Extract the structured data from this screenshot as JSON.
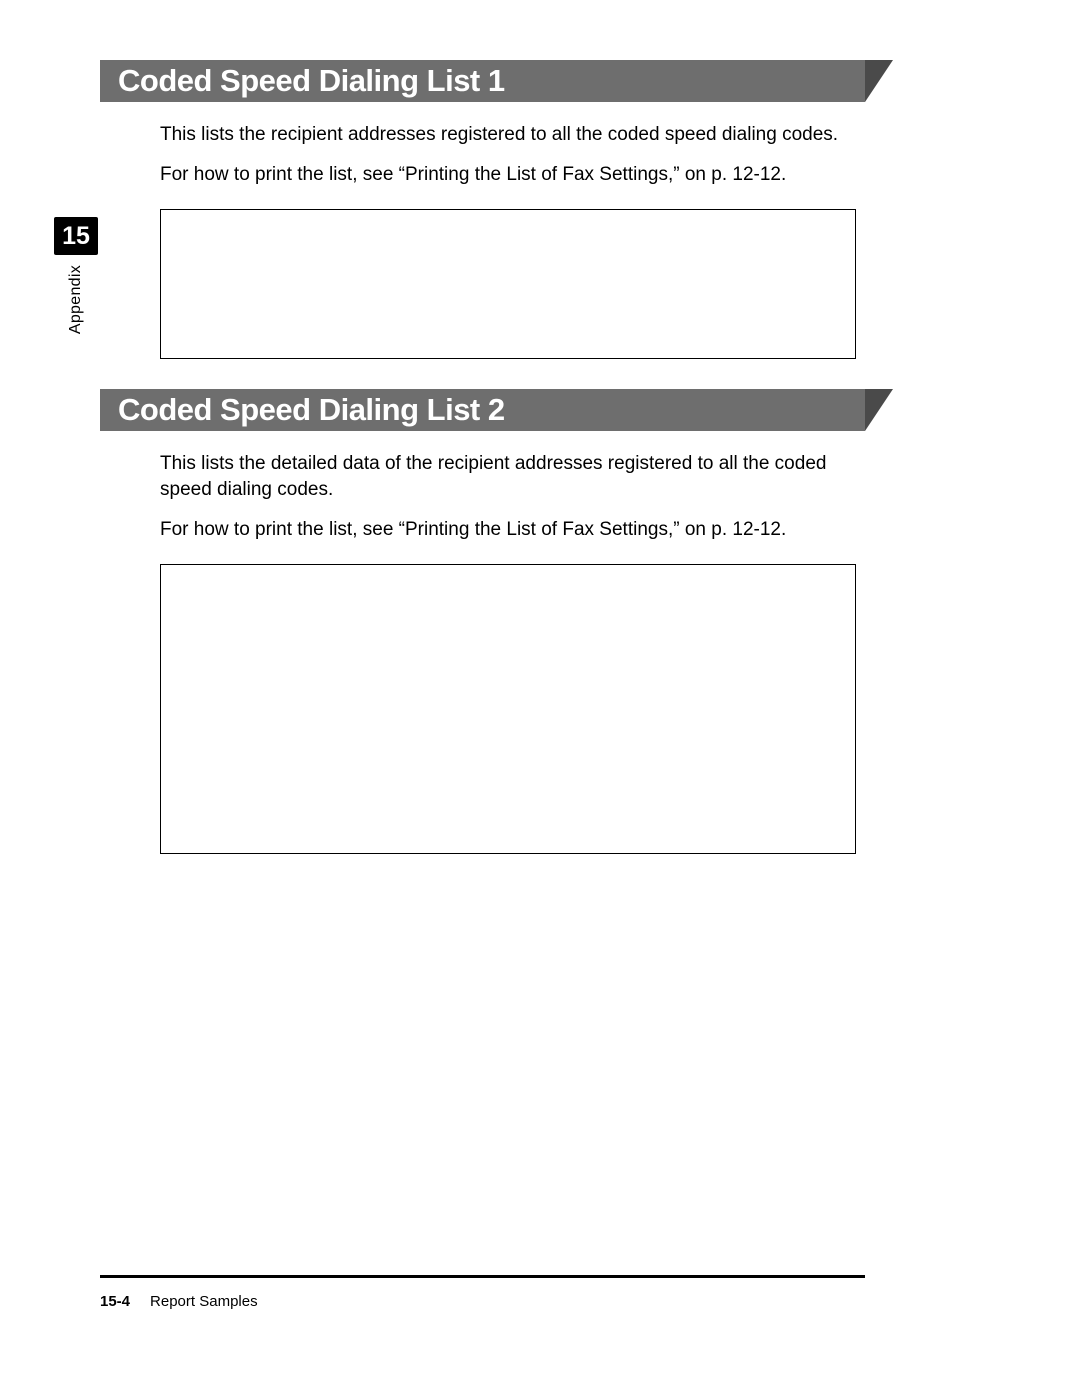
{
  "sidebar": {
    "chapter_number": "15",
    "chapter_title": "Appendix"
  },
  "sections": [
    {
      "heading": "Coded Speed Dialing List 1",
      "paragraphs": [
        "This lists the recipient addresses registered to all the coded speed dialing codes.",
        "For how to print the list, see “Printing the List of Fax Settings,” on p. 12-12."
      ]
    },
    {
      "heading": "Coded Speed Dialing List 2",
      "paragraphs": [
        "This lists the detailed data of the recipient addresses registered to all the coded speed dialing codes.",
        "For how to print the list, see “Printing the List of Fax Settings,” on p. 12-12."
      ]
    }
  ],
  "footer": {
    "page_number": "15-4",
    "section_title": "Report Samples"
  }
}
